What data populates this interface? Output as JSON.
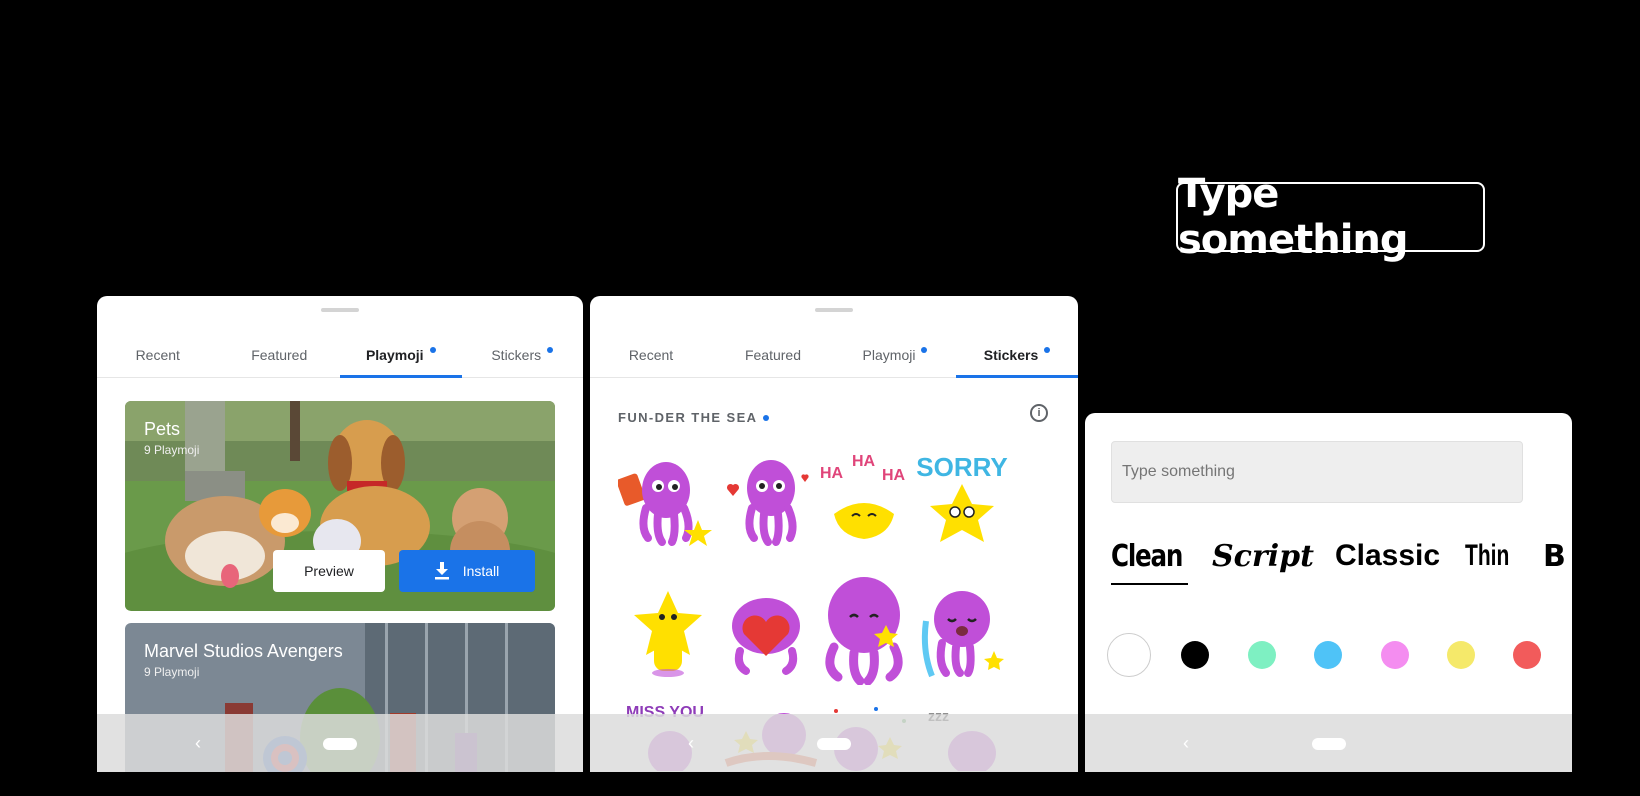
{
  "callout": {
    "text": "Type something"
  },
  "phone1": {
    "tabs": [
      {
        "label": "Recent",
        "dot": false,
        "active": false
      },
      {
        "label": "Featured",
        "dot": false,
        "active": false
      },
      {
        "label": "Playmoji",
        "dot": true,
        "active": true
      },
      {
        "label": "Stickers",
        "dot": true,
        "active": false
      }
    ],
    "cards": [
      {
        "title": "Pets",
        "subtitle": "9 Playmoji"
      },
      {
        "title": "Marvel Studios Avengers",
        "subtitle": "9 Playmoji"
      }
    ],
    "preview_label": "Preview",
    "install_label": "Install"
  },
  "phone2": {
    "tabs": [
      {
        "label": "Recent",
        "dot": false,
        "active": false
      },
      {
        "label": "Featured",
        "dot": false,
        "active": false
      },
      {
        "label": "Playmoji",
        "dot": true,
        "active": false
      },
      {
        "label": "Stickers",
        "dot": true,
        "active": true
      }
    ],
    "section_title": "FUN-DER THE SEA",
    "sticker_text": {
      "haha": [
        "HA",
        "HA",
        "HA"
      ],
      "sorry": "SORRY",
      "miss_you": "MISS YOU",
      "zzz": "zzz"
    }
  },
  "phone3": {
    "input_placeholder": "Type something",
    "fonts": [
      "Clean",
      "Script",
      "Classic",
      "Thin",
      "B"
    ],
    "colors": [
      "#ffffff",
      "#000000",
      "#7ef0c2",
      "#4fc3f7",
      "#f48df0",
      "#f5e96a",
      "#f25b5b"
    ]
  },
  "colors": {
    "accent": "#1a73e8",
    "octopus": "#c04fd8",
    "star": "#ffe000"
  }
}
